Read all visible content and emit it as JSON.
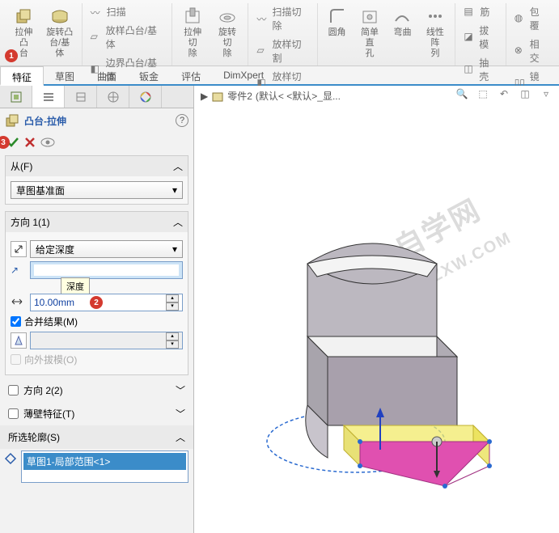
{
  "ribbon": {
    "extrude": "拉伸凸\n台",
    "revolve": "旋转凸\n台/基体",
    "sweep": "扫描",
    "loft": "放样凸台/基体",
    "boundary": "边界凸台/基体",
    "extrudeCut": "拉伸切\n除",
    "revolveCut": "旋转切\n除",
    "sweepCut": "扫描切除",
    "loftCut": "放样切割",
    "loftCut2": "放样切割",
    "fillet": "圆角",
    "hole": "简单直\n孔",
    "bend": "弯曲",
    "linear": "线性阵\n列",
    "rib": "筋",
    "draft": "拔模",
    "shell": "抽壳",
    "wrap": "包覆",
    "intersect": "相交",
    "mirror": "镜向"
  },
  "tabs": [
    "特征",
    "草图",
    "曲面",
    "钣金",
    "评估",
    "DimXpert"
  ],
  "activeTab": 0,
  "breadcrumb": {
    "part": "零件2",
    "state": "(默认< <默认>_显..."
  },
  "feature": {
    "title": "凸台-拉伸",
    "fromLabel": "从(F)",
    "fromValue": "草图基准面",
    "dir1Label": "方向 1(1)",
    "dir1Value": "给定深度",
    "depthTip": "深度",
    "depthValue": "10.00mm",
    "merge": "合并结果(M)",
    "draftOut": "向外拔模(O)",
    "dir2Label": "方向 2(2)",
    "thinLabel": "薄壁特征(T)",
    "contourLabel": "所选轮廓(S)",
    "contourItem": "草图1-局部范围<1>"
  },
  "badges": {
    "b1": "1",
    "b2": "2",
    "b3": "3"
  }
}
